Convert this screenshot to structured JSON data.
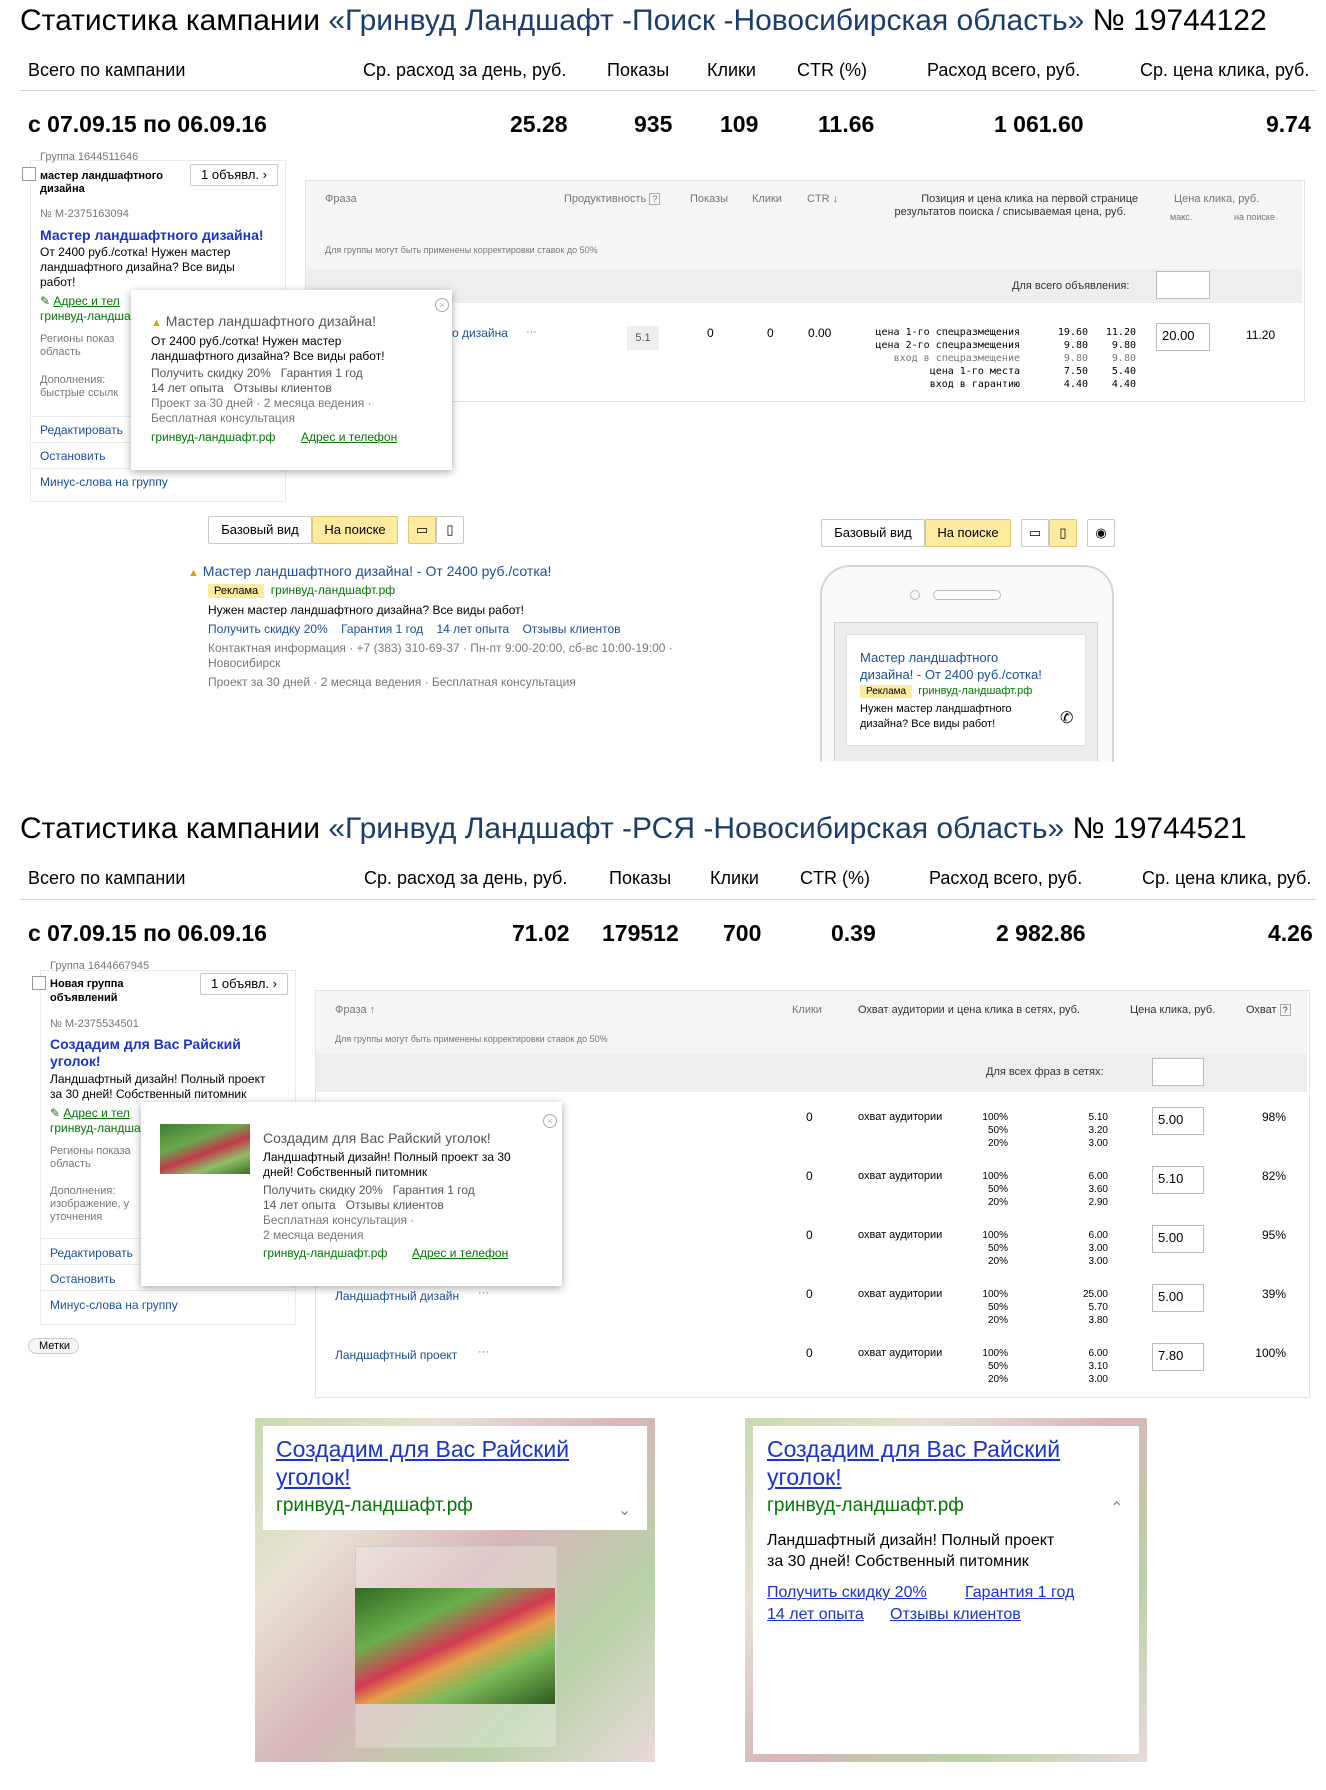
{
  "s1": {
    "title_prefix": "Статистика кампании ",
    "title_name": "«Гринвуд Ландшафт -Поиск -Новосибирская область»",
    "title_suffix": " № 19744122",
    "headers": [
      "Всего по кампании",
      "Ср. расход за день, руб.",
      "Показы",
      "Клики",
      "CTR (%)",
      "Расход всего, руб.",
      "Ср. цена клика, руб."
    ],
    "period": "с 07.09.15 по 06.09.16",
    "totals": [
      "25.28",
      "935",
      "109",
      "11.66",
      "1 061.60",
      "9.74"
    ],
    "group_id": "Группа 1644511646",
    "group_name": "мастер ландшафтного дизайна",
    "ads_btn": "1 объявл. ›",
    "ad_id": "№ M-2375163094",
    "ad_title": "Мастер ландшафтного дизайна!",
    "ad_text": [
      "От 2400 руб./сотка! Нужен мастер",
      "ландшафтного дизайна? Все виды",
      "работ!"
    ],
    "addr_link": "Адрес и тел",
    "domain_short": "гринвуд-ландша",
    "regions_l1": "Регионы показ",
    "regions_l2": "область",
    "addons_l1": "Дополнения:",
    "addons_l2": "быстрые ссылк",
    "edit": "Редактировать",
    "stop": "Остановить",
    "minus": "Минус-слова на группу",
    "col_phrase": "Фраза",
    "col_prod": "Продуктивность",
    "col_shows": "Показы",
    "col_clicks": "Клики",
    "col_ctr": "CTR ↓",
    "col_pos_l1": "Позиция и цена клика на первой странице",
    "col_pos_l2": "результатов поиска / списываемая цена, руб.",
    "col_price": "Цена клика, руб.",
    "col_max": "макс.",
    "col_onsearch": "на поиске",
    "corr_note": "Для группы могут быть применены корректировки ставок до 50%",
    "all_ad": "Для всего объявления:",
    "row": {
      "phrase": "о дизайна",
      "prod": "5.1",
      "shows": "0",
      "clicks": "0",
      "ctr": "0.00",
      "pos_labels": [
        "цена 1-го спецразмещения",
        "цена 2-го спецразмещения",
        "вход в спецразмещение",
        "цена 1-го места",
        "вход в гарантию"
      ],
      "pos_a": [
        "19.60",
        "9.80",
        "9.80",
        "7.50",
        "4.40"
      ],
      "pos_b": [
        "11.20",
        "9.80",
        "9.80",
        "5.40",
        "4.40"
      ],
      "max": "20.00",
      "onsearch": "11.20"
    },
    "popup": {
      "title": "Мастер ландшафтного дизайна!",
      "text": [
        "От 2400 руб./сотка! Нужен мастер",
        "ландшафтного дизайна? Все виды работ!"
      ],
      "links1": "Получить скидку 20%   Гарантия 1 год",
      "links2": "14 лет опыта   Отзывы клиентов",
      "extra1": "Проект за 30 дней  ·  2 месяца ведения  ·",
      "extra2": "Бесплатная консультация",
      "domain": "гринвуд-ландшафт.рф",
      "addr": "Адрес и телефон"
    },
    "view_basic": "Базовый вид",
    "view_search": "На поиске",
    "preview": {
      "title": "Мастер ландшафтного дизайна! - От 2400 руб./сотка!",
      "badge": "Реклама",
      "domain": "гринвуд-ландшафт.рф",
      "text": "Нужен мастер ландшафтного дизайна? Все виды работ!",
      "links": [
        "Получить скидку 20%",
        "Гарантия 1 год",
        "14 лет опыта",
        "Отзывы клиентов"
      ],
      "contact": "Контактная информация  ·  +7 (383) 310-69-37  ·  Пн-пт 9:00-20:00, сб-вс 10:00-19:00  ·",
      "city": "Новосибирск",
      "extras": "Проект за 30 дней  ·  2 месяца ведения  ·  Бесплатная консультация"
    },
    "mobile": {
      "title_l1": "Мастер ландшафтного",
      "title_l2": "дизайна! - От 2400 руб./сотка!",
      "badge": "Реклама",
      "domain": "гринвуд-ландшафт.рф",
      "text_l1": "Нужен мастер ландшафтного",
      "text_l2": "дизайна? Все виды работ!"
    }
  },
  "s2": {
    "title_prefix": "Статистика кампании ",
    "title_name": "«Гринвуд Ландшафт -РСЯ -Новосибирская область»",
    "title_suffix": " № 19744521",
    "headers": [
      "Всего по кампании",
      "Ср. расход за день, руб.",
      "Показы",
      "Клики",
      "CTR (%)",
      "Расход всего, руб.",
      "Ср. цена клика, руб."
    ],
    "period": "с 07.09.15 по 06.09.16",
    "totals": [
      "71.02",
      "179512",
      "700",
      "0.39",
      "2 982.86",
      "4.26"
    ],
    "group_id": "Группа 1644667945",
    "group_l1": "Новая группа",
    "group_l2": "объявлений",
    "ads_btn": "1 объявл. ›",
    "ad_id": "№ M-2375534501",
    "ad_title_l1": "Создадим для Вас Райский",
    "ad_title_l2": "уголок!",
    "ad_text": [
      "Ландшафтный дизайн! Полный проект",
      "за 30 дней! Собственный питомник"
    ],
    "addr_link": "Адрес и тел",
    "domain_short": "гринвуд-ландша",
    "regions_l1": "Регионы показа",
    "regions_l2": "область",
    "addons_l1": "Дополнения:",
    "addons_l2": "изображение, у",
    "addons_l3": "уточнения",
    "edit": "Редактировать",
    "stop": "Остановить",
    "minus": "Минус-слова на группу",
    "tags": "Метки",
    "col_phrase": "Фраза ↑",
    "col_clicks": "Клики",
    "col_reach": "Охват аудитории и цена клика в сетях, руб.",
    "col_price": "Цена клика, руб.",
    "col_cover": "Охват",
    "corr_note": "Для группы могут быть применены корректировки ставок до 50%",
    "all_phrases": "Для всех фраз в сетях:",
    "reach_label": "охват аудитории",
    "pcts": [
      "100%",
      "50%",
      "20%"
    ],
    "rows": [
      {
        "phrase": "",
        "clicks": "0",
        "vals": [
          "5.10",
          "3.20",
          "3.00"
        ],
        "price": "5.00",
        "cover": "98%"
      },
      {
        "phrase": "",
        "clicks": "0",
        "vals": [
          "6.00",
          "3.60",
          "2.90"
        ],
        "price": "5.10",
        "cover": "82%"
      },
      {
        "phrase": "",
        "clicks": "0",
        "vals": [
          "6.00",
          "3.00",
          "3.00"
        ],
        "price": "5.00",
        "cover": "95%"
      },
      {
        "phrase": "Ландшафтный дизайн",
        "clicks": "0",
        "vals": [
          "25.00",
          "5.70",
          "3.80"
        ],
        "price": "5.00",
        "cover": "39%"
      },
      {
        "phrase": "Ландшафтный проект",
        "clicks": "0",
        "vals": [
          "6.00",
          "3.10",
          "3.00"
        ],
        "price": "7.80",
        "cover": "100%"
      }
    ],
    "popup": {
      "title": "Создадим для Вас Райский уголок!",
      "text": [
        "Ландшафтный дизайн! Полный проект за 30",
        "дней! Собственный питомник"
      ],
      "links1": "Получить скидку 20%   Гарантия 1 год",
      "links2": "14 лет опыта   Отзывы клиентов",
      "extra1": "Бесплатная консультация  ·",
      "extra2": "2 месяца ведения",
      "domain": "гринвуд-ландшафт.рф",
      "addr": "Адрес и телефон"
    },
    "card1": {
      "title_l1": "Создадим для Вас Райский",
      "title_l2": "уголок!",
      "domain": "гринвуд-ландшафт.рф"
    },
    "card2": {
      "title_l1": "Создадим для Вас Райский",
      "title_l2": "уголок!",
      "domain": "гринвуд-ландшафт.рф",
      "text_l1": "Ландшафтный дизайн! Полный проект",
      "text_l2": "за 30 дней! Собственный питомник",
      "links": [
        "Получить скидку 20%",
        "Гарантия 1 год",
        "14 лет опыта",
        "Отзывы клиентов"
      ]
    }
  }
}
